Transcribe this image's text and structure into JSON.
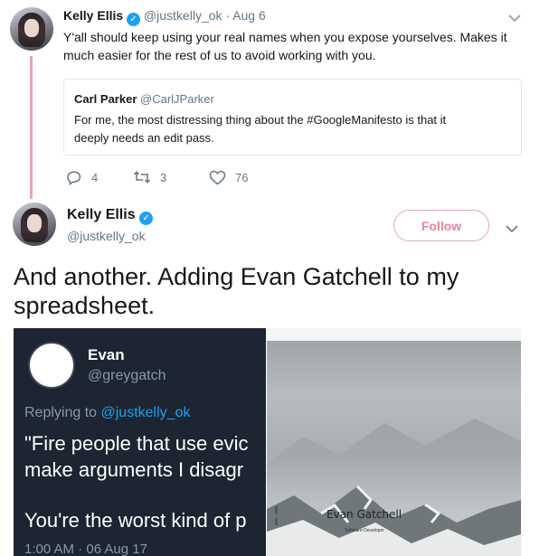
{
  "tweet1": {
    "display_name": "Kelly Ellis",
    "handle": "@justkelly_ok",
    "date": "· Aug 6",
    "text_line1": "Y'all should keep using your real names when you expose yourselves. Makes it",
    "text_line2": "much easier for the rest of us to avoid working with you.",
    "quoted": {
      "display_name": "Carl Parker",
      "handle": "@CarlJParker",
      "text_line1": "For me, the most distressing thing about the #GoogleManifesto is that it",
      "text_line2": "deeply needs an edit pass."
    },
    "actions": {
      "replies": "4",
      "retweets": "3",
      "likes": "76"
    }
  },
  "tweet2": {
    "display_name": "Kelly Ellis",
    "handle": "@justkelly_ok",
    "follow_label": "Follow",
    "text_line1": "And another. Adding Evan Gatchell to my",
    "text_line2": "spreadsheet.",
    "embedded_left": {
      "name": "Evan",
      "handle": "@greygatch",
      "replying_prefix": "Replying to ",
      "replying_handle": "@justkelly_ok",
      "quote_line1": "\"Fire people that use evic",
      "quote_line2": "make arguments I disagr",
      "quote_line3": "You're the worst kind of p",
      "timestamp": "1:00 AM · 06 Aug 17"
    },
    "embedded_right": {
      "title": "Evan Gatchell",
      "subtitle": "Software Developer"
    }
  },
  "colors": {
    "accent_pink": "#e3859a",
    "verified_blue": "#1da1f2",
    "mention_blue": "#1da1f2",
    "dark_bg": "#1c2531"
  }
}
